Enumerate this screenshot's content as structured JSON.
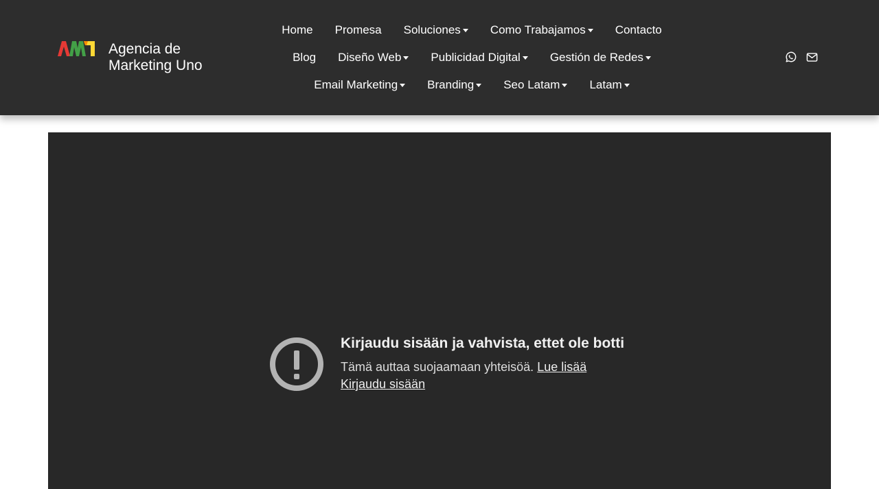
{
  "brand": {
    "name": "Agencia de Marketing Uno",
    "logo_text": "AM1",
    "logo_colors": [
      "#e53935",
      "#fb8c00",
      "#43a047",
      "#fdd835"
    ]
  },
  "nav": {
    "rows": [
      [
        {
          "label": "Home",
          "dropdown": false
        },
        {
          "label": "Promesa",
          "dropdown": false
        },
        {
          "label": "Soluciones",
          "dropdown": true
        },
        {
          "label": "Como Trabajamos",
          "dropdown": true
        },
        {
          "label": "Contacto",
          "dropdown": false
        }
      ],
      [
        {
          "label": "Blog",
          "dropdown": false
        },
        {
          "label": "Diseño Web",
          "dropdown": true
        },
        {
          "label": "Publicidad Digital",
          "dropdown": true
        },
        {
          "label": "Gestión de Redes",
          "dropdown": true
        }
      ],
      [
        {
          "label": "Email Marketing",
          "dropdown": true
        },
        {
          "label": "Branding",
          "dropdown": true
        },
        {
          "label": "Seo Latam",
          "dropdown": true
        },
        {
          "label": "Latam",
          "dropdown": true
        }
      ]
    ]
  },
  "social": {
    "icons": [
      "whatsapp-icon",
      "envelope-icon"
    ]
  },
  "video": {
    "title": "Kirjaudu sisään ja vahvista, ettet ole botti",
    "body": "Tämä auttaa suojaamaan yhteisöä.",
    "learn_more": "Lue lisää",
    "sign_in": "Kirjaudu sisään",
    "icon": "alert-circle-icon"
  },
  "colors": {
    "navbar_bg": "#2d2d2d",
    "video_bg": "#282828",
    "text": "#ffffff"
  }
}
